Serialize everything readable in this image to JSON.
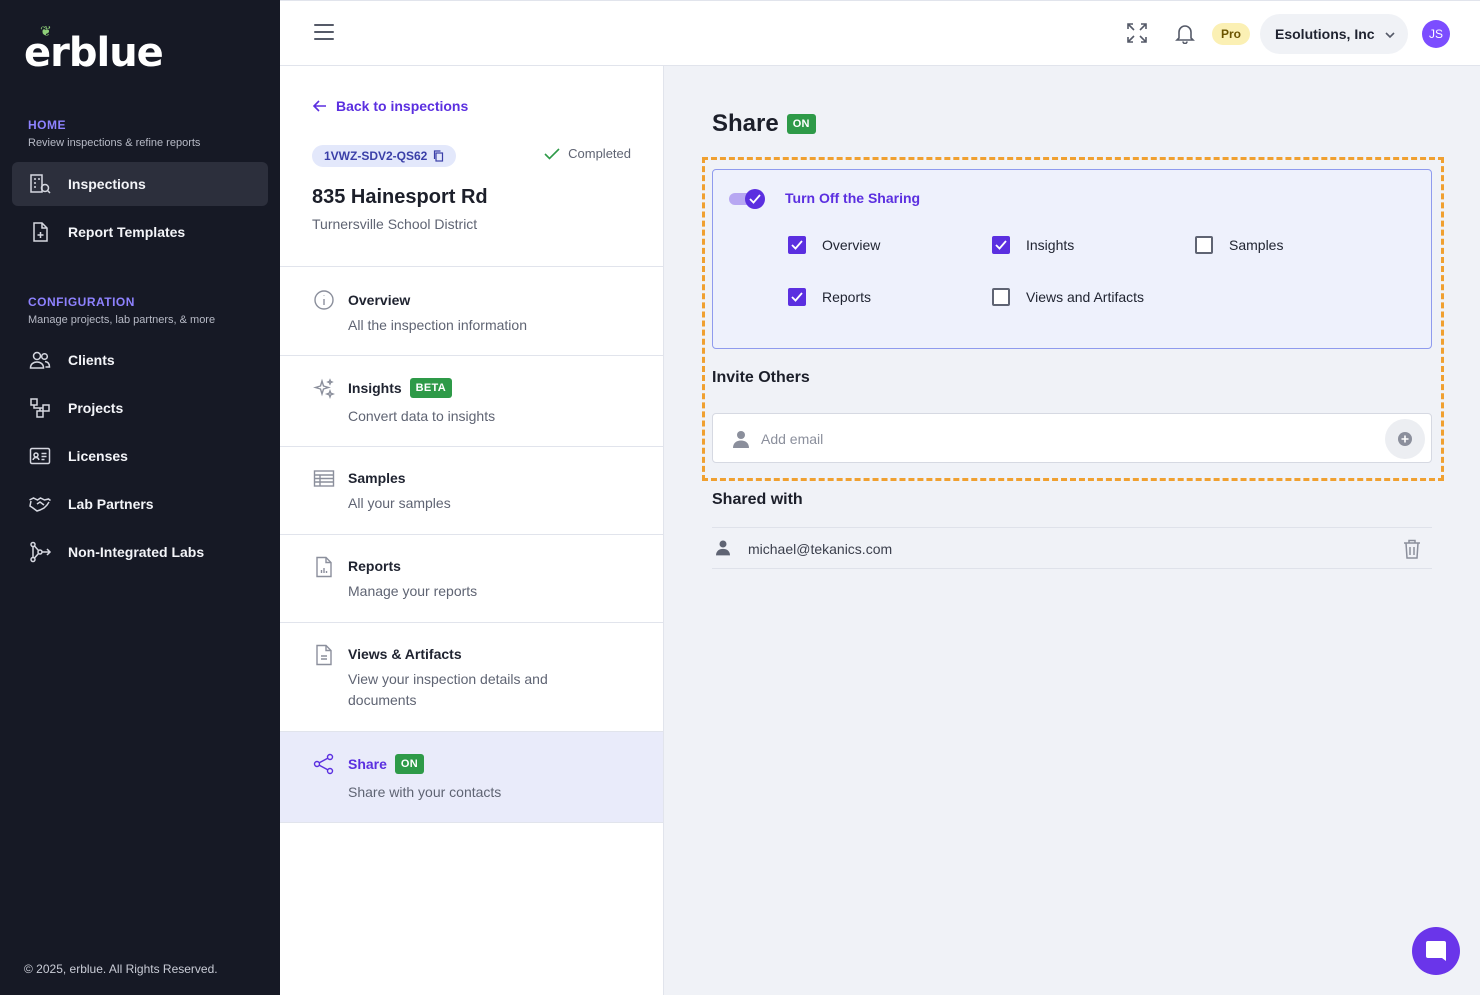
{
  "sidebar": {
    "logo": "erblue",
    "home_title": "HOME",
    "home_sub": "Review inspections & refine reports",
    "config_title": "CONFIGURATION",
    "config_sub": "Manage projects, lab partners, & more",
    "items": [
      {
        "label": "Inspections",
        "icon": "inspections-icon"
      },
      {
        "label": "Report Templates",
        "icon": "report-templates-icon"
      },
      {
        "label": "Clients",
        "icon": "clients-icon"
      },
      {
        "label": "Projects",
        "icon": "projects-icon"
      },
      {
        "label": "Licenses",
        "icon": "licenses-icon"
      },
      {
        "label": "Lab Partners",
        "icon": "handshake-icon"
      },
      {
        "label": "Non-Integrated Labs",
        "icon": "branch-icon"
      }
    ],
    "copyright": "© 2025, erblue. All Rights Reserved."
  },
  "topbar": {
    "pro_label": "Pro",
    "org_name": "Esolutions, Inc",
    "avatar_initials": "JS"
  },
  "inspection": {
    "back_label": "Back to inspections",
    "id": "1VWZ-SDV2-QS62",
    "status": "Completed",
    "address": "835 Hainesport Rd",
    "district": "Turnersville School District"
  },
  "menu": [
    {
      "title": "Overview",
      "desc": "All the inspection information",
      "tag": ""
    },
    {
      "title": "Insights",
      "desc": "Convert data to insights",
      "tag": "BETA"
    },
    {
      "title": "Samples",
      "desc": "All your samples",
      "tag": ""
    },
    {
      "title": "Reports",
      "desc": "Manage your reports",
      "tag": ""
    },
    {
      "title": "Views & Artifacts",
      "desc": "View your inspection details and documents",
      "tag": ""
    },
    {
      "title": "Share",
      "desc": "Share with your contacts",
      "tag": "ON"
    }
  ],
  "share": {
    "title": "Share",
    "status_tag": "ON",
    "toggle_label": "Turn Off the Sharing",
    "toggle_on": true,
    "options": [
      {
        "label": "Overview",
        "checked": true
      },
      {
        "label": "Insights",
        "checked": true
      },
      {
        "label": "Samples",
        "checked": false
      },
      {
        "label": "Reports",
        "checked": true
      },
      {
        "label": "Views and Artifacts",
        "checked": false
      }
    ],
    "invite_title": "Invite Others",
    "invite_placeholder": "Add email",
    "shared_title": "Shared with",
    "shared_with": [
      "michael@tekanics.com"
    ]
  },
  "colors": {
    "accent": "#5b2fe0",
    "sidebar_bg": "#161925",
    "highlight_border": "#f0a030",
    "tag_green": "#2e9a48"
  }
}
